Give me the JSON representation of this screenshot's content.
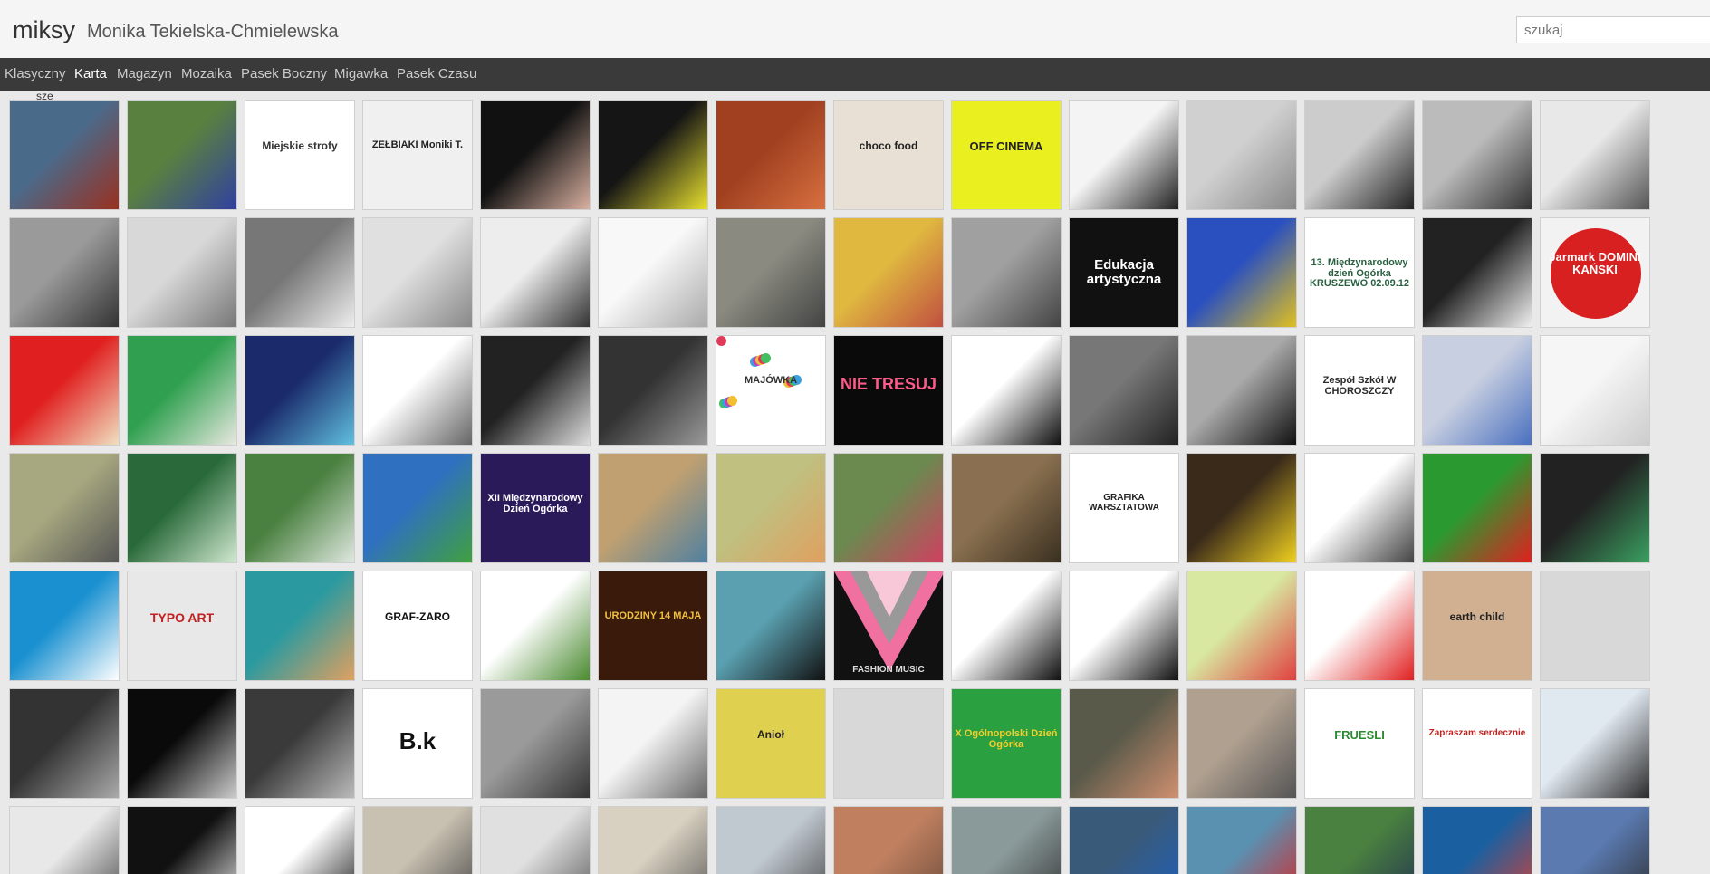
{
  "header": {
    "blog_title": "miksy",
    "blog_description": "Monika Tekielska-Chmielewska"
  },
  "search": {
    "placeholder": "szukaj"
  },
  "nav": {
    "tabs": [
      {
        "label": "Klasyczny",
        "active": false
      },
      {
        "label": "Karta",
        "active": true
      },
      {
        "label": "Magazyn",
        "active": false
      },
      {
        "label": "Mozaika",
        "active": false
      },
      {
        "label": "Pasek Boczny",
        "active": false
      },
      {
        "label": "Migawka",
        "active": false
      },
      {
        "label": "Pasek Czasu",
        "active": false
      }
    ]
  },
  "fragment_text": "sze",
  "tiles": [
    [
      {
        "bg": "#4a6a8a",
        "bg2": "#9a3020"
      },
      {
        "bg": "#5a8040",
        "bg2": "#3040a0"
      },
      {
        "bg": "#ffffff",
        "fg": "#333",
        "t": "Miejskie strofy",
        "s": 12
      },
      {
        "bg": "#f0f0f0",
        "fg": "#222",
        "t": "ZEŁBIAKI Moniki T.",
        "s": 11
      },
      {
        "bg": "#111111",
        "bg2": "#d9b0a0"
      },
      {
        "bg": "#151515",
        "bg2": "#e8e030"
      },
      {
        "bg": "#a04020",
        "bg2": "#d87040"
      },
      {
        "bg": "#e8e0d4",
        "fg": "#222",
        "t": "choco food",
        "s": 12
      },
      {
        "bg": "#eaf020",
        "fg": "#222",
        "t": "OFF CINEMA",
        "s": 13
      },
      {
        "bg": "#f4f4f4",
        "bg2": "#222"
      },
      {
        "bg": "#d0d0d0",
        "bg2": "#888"
      },
      {
        "bg": "#cccccc",
        "bg2": "#222"
      },
      {
        "bg": "#bbbbbb",
        "bg2": "#333"
      },
      {
        "bg": "#e8e8e8",
        "bg2": "#555"
      }
    ],
    [
      {
        "bg": "#9a9a9a",
        "bg2": "#333"
      },
      {
        "bg": "#d8d8d8",
        "bg2": "#777"
      },
      {
        "bg": "#777777",
        "bg2": "#eee"
      },
      {
        "bg": "#e0e0e0",
        "bg2": "#888"
      },
      {
        "bg": "#ededed",
        "bg2": "#333"
      },
      {
        "bg": "#f8f8f8",
        "bg2": "#aaa"
      },
      {
        "bg": "#8a8a80",
        "bg2": "#444"
      },
      {
        "bg": "#e0b840",
        "bg2": "#c05040"
      },
      {
        "bg": "#a0a0a0",
        "bg2": "#444"
      },
      {
        "bg": "#111111",
        "fg": "#fff",
        "t": "Edukacja artystyczna",
        "s": 15
      },
      {
        "bg": "#2a50c0",
        "bg2": "#e0c020"
      },
      {
        "bg": "#ffffff",
        "fg": "#2a6040",
        "t": "13. Międzynarodowy dzień Ogórka KRUSZEWO 02.09.12",
        "s": 11
      },
      {
        "bg": "#222222",
        "bg2": "#f0f0f0"
      },
      {
        "bg": "#f2f2f2",
        "fg": "#fff",
        "t": "Jarmark DOMINI KAŃSKI",
        "s": 13,
        "circle": "#d82020"
      }
    ],
    [
      {
        "bg": "#e02020",
        "bg2": "#f0e0c0"
      },
      {
        "bg": "#30a050",
        "bg2": "#e8e8e0"
      },
      {
        "bg": "#1a2a6a",
        "bg2": "#60c0e0"
      },
      {
        "bg": "#ffffff",
        "bg2": "#666"
      },
      {
        "bg": "#222222",
        "bg2": "#ddd"
      },
      {
        "bg": "#333333",
        "bg2": "#999"
      },
      {
        "bg": "#ffffff",
        "fg": "#333",
        "t": "MAJÓWKA",
        "s": 11,
        "dots": true
      },
      {
        "bg": "#0a0a0a",
        "fg": "#ff5a8a",
        "t": "NIE TRESUJ",
        "s": 18
      },
      {
        "bg": "#ffffff",
        "bg2": "#111"
      },
      {
        "bg": "#777777",
        "bg2": "#222"
      },
      {
        "bg": "#aaaaaa",
        "bg2": "#111"
      },
      {
        "bg": "#ffffff",
        "fg": "#2a2a2a",
        "t": "Zespół Szkół W CHOROSZCZY",
        "s": 11
      },
      {
        "bg": "#c8cfe0",
        "bg2": "#4a70c0"
      },
      {
        "bg": "#f6f6f6",
        "bg2": "#ccc"
      }
    ],
    [
      {
        "bg": "#a8a880",
        "bg2": "#555"
      },
      {
        "bg": "#2a6a3a",
        "bg2": "#d0e8d0"
      },
      {
        "bg": "#4a8040",
        "bg2": "#e0e8e0"
      },
      {
        "bg": "#3070c0",
        "bg2": "#40a040"
      },
      {
        "bg": "#2a1a5a",
        "fg": "#fff",
        "t": "XII Międzynarodowy Dzień Ogórka",
        "s": 11
      },
      {
        "bg": "#c0a070",
        "bg2": "#5080a0"
      },
      {
        "bg": "#c0c080",
        "bg2": "#e0a060"
      },
      {
        "bg": "#6a8a50",
        "bg2": "#d04060"
      },
      {
        "bg": "#8a7050",
        "bg2": "#3a3020"
      },
      {
        "bg": "#ffffff",
        "fg": "#222",
        "t": "GRAFIKA WARSZTATOWA",
        "s": 10
      },
      {
        "bg": "#3a2a1a",
        "bg2": "#f0d020"
      },
      {
        "bg": "#ffffff",
        "bg2": "#444"
      },
      {
        "bg": "#2a9a30",
        "bg2": "#e02020"
      },
      {
        "bg": "#222222",
        "bg2": "#3aa060"
      }
    ],
    [
      {
        "bg": "#1a90d0",
        "bg2": "#ffffff"
      },
      {
        "bg": "#e8e8e8",
        "fg": "#c02020",
        "t": "TYPO ART",
        "s": 14
      },
      {
        "bg": "#2a9aa0",
        "bg2": "#e0a060"
      },
      {
        "bg": "#ffffff",
        "fg": "#111",
        "t": "GRAF-ZARO",
        "s": 12
      },
      {
        "bg": "#ffffff",
        "bg2": "#4a8a30"
      },
      {
        "bg": "#3a1a0a",
        "fg": "#f0c040",
        "t": "URODZINY 14 MAJA",
        "s": 11
      },
      {
        "bg": "#5aa0b0",
        "bg2": "#111"
      },
      {
        "bg": "#111111",
        "fg": "#ddd",
        "t": "FASHION MUSIC",
        "s": 10,
        "chevron": true
      },
      {
        "bg": "#ffffff",
        "bg2": "#111"
      },
      {
        "bg": "#ffffff",
        "bg2": "#111"
      },
      {
        "bg": "#d8e8a0",
        "bg2": "#e04040"
      },
      {
        "bg": "#ffffff",
        "bg2": "#e02020"
      },
      {
        "bg": "#d0b090",
        "fg": "#222",
        "t": "earth child",
        "s": 12
      },
      {
        "bg": "#d8d8d8",
        "bg2": "#d8d8d8"
      }
    ],
    [
      {
        "bg": "#333333",
        "bg2": "#aaa"
      },
      {
        "bg": "#0a0a0a",
        "bg2": "#ccc"
      },
      {
        "bg": "#3a3a3a",
        "bg2": "#bbb"
      },
      {
        "bg": "#ffffff",
        "fg": "#111",
        "t": "B.k",
        "s": 26
      },
      {
        "bg": "#9a9a9a",
        "bg2": "#333"
      },
      {
        "bg": "#f4f4f4",
        "bg2": "#666"
      },
      {
        "bg": "#e0d050",
        "fg": "#222",
        "t": "Anioł",
        "s": 12
      },
      {
        "bg": "#d8d8d8",
        "bg2": "#d8d8d8"
      },
      {
        "bg": "#2aa040",
        "fg": "#f0d030",
        "t": "X Ogólnopolski Dzień Ogórka",
        "s": 11
      },
      {
        "bg": "#5a5a4a",
        "bg2": "#d09070"
      },
      {
        "bg": "#b0a090",
        "bg2": "#555"
      },
      {
        "bg": "#ffffff",
        "fg": "#2a8a30",
        "t": "FRUESLI",
        "s": 13
      },
      {
        "bg": "#ffffff",
        "fg": "#c02020",
        "t": "Zapraszam serdecznie",
        "s": 10
      },
      {
        "bg": "#e0e8f0",
        "bg2": "#2a2a2a"
      }
    ],
    [
      {
        "bg": "#e8e8e8",
        "bg2": "#444"
      },
      {
        "bg": "#111111",
        "bg2": "#eee"
      },
      {
        "bg": "#ffffff",
        "bg2": "#111"
      },
      {
        "bg": "#c8c0b0",
        "bg2": "#444"
      },
      {
        "bg": "#e0e0e0",
        "bg2": "#555"
      },
      {
        "bg": "#d8d0c0",
        "bg2": "#555"
      },
      {
        "bg": "#c0c8d0",
        "bg2": "#444"
      },
      {
        "bg": "#c08060",
        "bg2": "#6a4a3a"
      },
      {
        "bg": "#8a9a9a",
        "bg2": "#333"
      },
      {
        "bg": "#3a5a7a",
        "bg2": "#1a60c0"
      },
      {
        "bg": "#5a90b0",
        "bg2": "#e02020"
      },
      {
        "bg": "#4a8040",
        "bg2": "#203050"
      },
      {
        "bg": "#1a60a0",
        "bg2": "#e04030"
      },
      {
        "bg": "#5a7ab0",
        "bg2": "#2a2a2a"
      }
    ]
  ]
}
